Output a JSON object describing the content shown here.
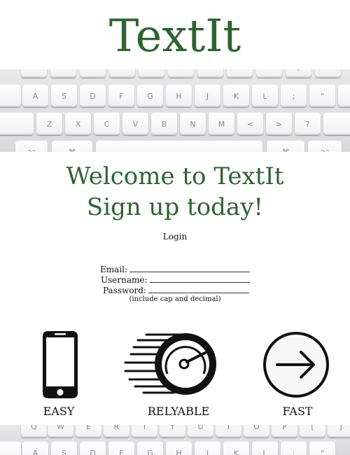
{
  "brand": {
    "title": "TextIt"
  },
  "hero": {
    "line1": "Welcome to TextIt",
    "line2": "Sign up today!"
  },
  "nav": {
    "login_label": "Login"
  },
  "form": {
    "email_label": "Email:",
    "username_label": "Username:",
    "password_label": "Password:",
    "password_hint": "(include cap and decimal)"
  },
  "features": [
    {
      "label": "EASY",
      "icon": "smartphone-icon"
    },
    {
      "label": "RELYABLE",
      "icon": "speedometer-icon"
    },
    {
      "label": "FAST",
      "icon": "arrow-right-circle-icon"
    }
  ],
  "keyboard": {
    "row_top_partial": [
      "",
      "",
      "",
      "",
      "",
      "",
      "",
      "",
      "",
      "[",
      ""
    ],
    "row_home": [
      "A",
      "S",
      "D",
      "F",
      "G",
      "H",
      "J",
      "K",
      "L",
      ";",
      "\""
    ],
    "row_bottom": [
      "Z",
      "X",
      "C",
      "V",
      "B",
      "N",
      "M",
      "<",
      ">",
      "?"
    ],
    "row_space_left": "⌥",
    "row_space_cmd": "⌘",
    "row_space_right_cmd": "⌘",
    "row_space_right_opt": "⌥",
    "row_lower_top": [
      "Q",
      "W",
      "E",
      "R",
      "T",
      "Y",
      "U",
      "I",
      "O",
      "P",
      "[",
      "]"
    ],
    "row_lower_home": [
      "A",
      "S",
      "D",
      "F",
      "G",
      "H",
      "J",
      "K",
      "L",
      ";",
      "\""
    ]
  },
  "colors": {
    "brand_green": "#2e6431"
  }
}
